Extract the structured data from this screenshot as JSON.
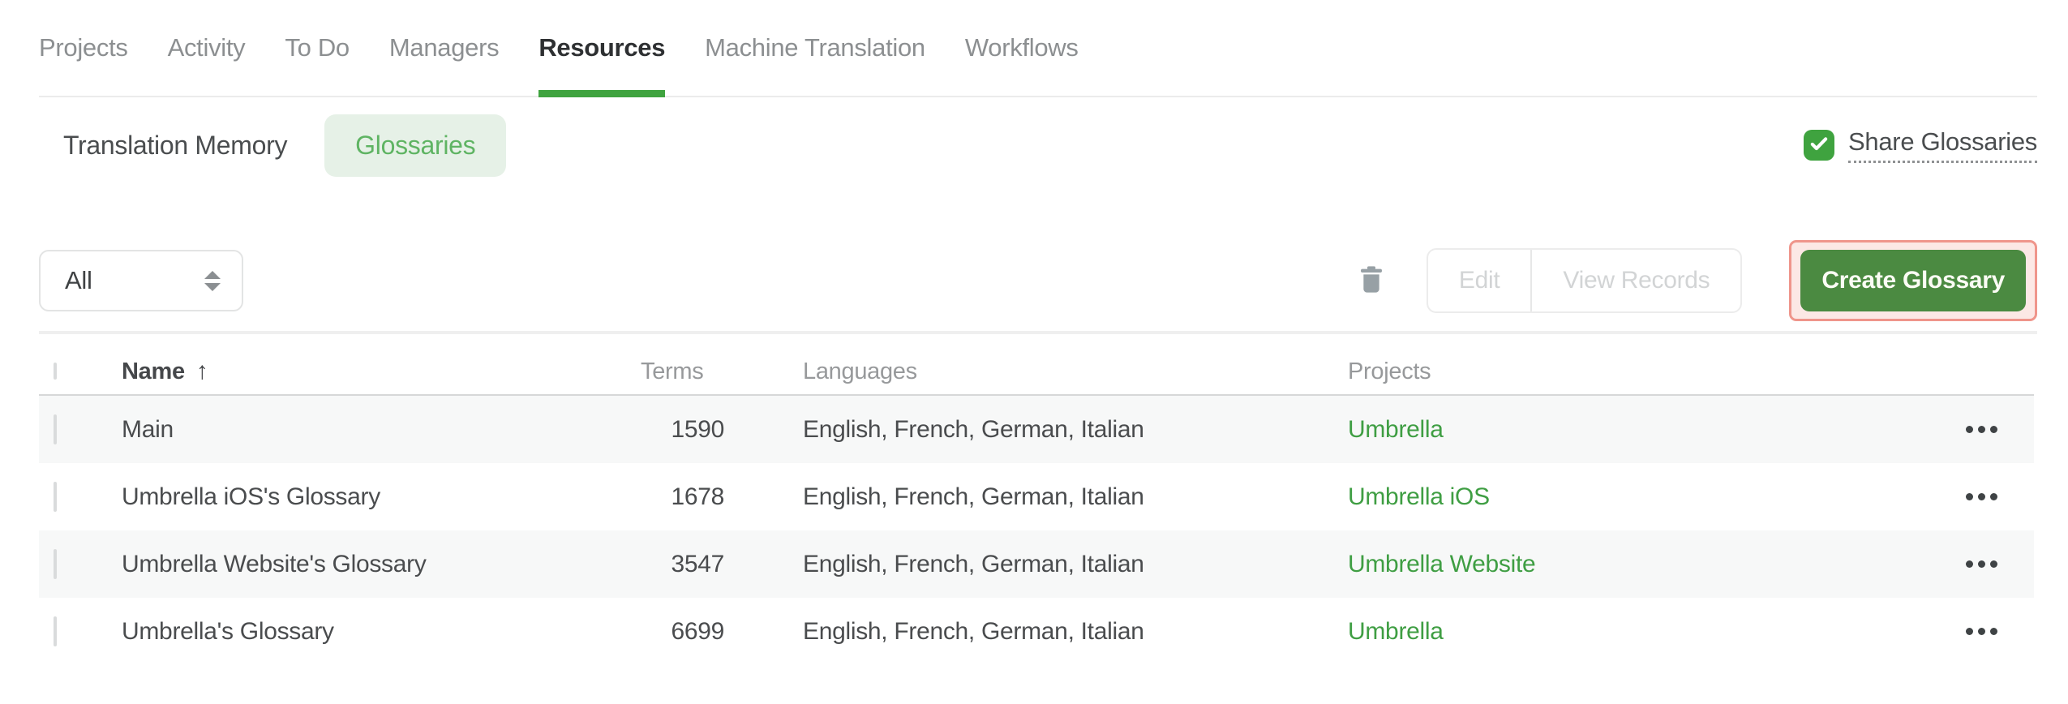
{
  "nav": {
    "tabs": [
      {
        "label": "Projects",
        "active": false
      },
      {
        "label": "Activity",
        "active": false
      },
      {
        "label": "To Do",
        "active": false
      },
      {
        "label": "Managers",
        "active": false
      },
      {
        "label": "Resources",
        "active": true
      },
      {
        "label": "Machine Translation",
        "active": false
      },
      {
        "label": "Workflows",
        "active": false
      }
    ]
  },
  "subnav": {
    "translation_memory_label": "Translation Memory",
    "glossaries_label": "Glossaries",
    "active_tab": "Glossaries",
    "share_glossaries": {
      "label": "Share Glossaries",
      "checked": true
    }
  },
  "toolbar": {
    "filter_value": "All",
    "edit_label": "Edit",
    "view_records_label": "View Records",
    "edit_enabled": false,
    "view_records_enabled": false,
    "create_glossary_label": "Create Glossary",
    "create_glossary_highlighted": true
  },
  "table": {
    "headers": {
      "name": "Name",
      "terms": "Terms",
      "languages": "Languages",
      "projects": "Projects"
    },
    "sort": {
      "column": "Name",
      "direction": "ascending",
      "arrow": "↑"
    },
    "rows": [
      {
        "name": "Main",
        "terms": "1590",
        "languages": "English, French, German, Italian",
        "project": "Umbrella",
        "checked": false
      },
      {
        "name": "Umbrella iOS's Glossary",
        "terms": "1678",
        "languages": "English, French, German, Italian",
        "project": "Umbrella iOS",
        "checked": false
      },
      {
        "name": "Umbrella Website's Glossary",
        "terms": "3547",
        "languages": "English, French, German, Italian",
        "project": "Umbrella Website",
        "checked": false
      },
      {
        "name": "Umbrella's Glossary",
        "terms": "6699",
        "languages": "English, French, German, Italian",
        "project": "Umbrella",
        "checked": false
      }
    ]
  },
  "icons": {
    "share_checkbox": "checkmark-icon",
    "filter_sorter": "up-down-sorter-icon",
    "delete": "trash-icon",
    "row_menu": "more-options-icon"
  },
  "colors": {
    "accent_green": "#3fa33f",
    "button_green": "#4b8a41",
    "link_green": "#3f9e43",
    "pill_bg": "#e6f1e7",
    "pill_text": "#5fb463",
    "highlight_border": "#ef958b",
    "highlight_bg": "#fce8e5",
    "row_stripe": "#f7f8f8",
    "muted_text": "#97999b",
    "disabled_text": "#d2d4d5"
  }
}
